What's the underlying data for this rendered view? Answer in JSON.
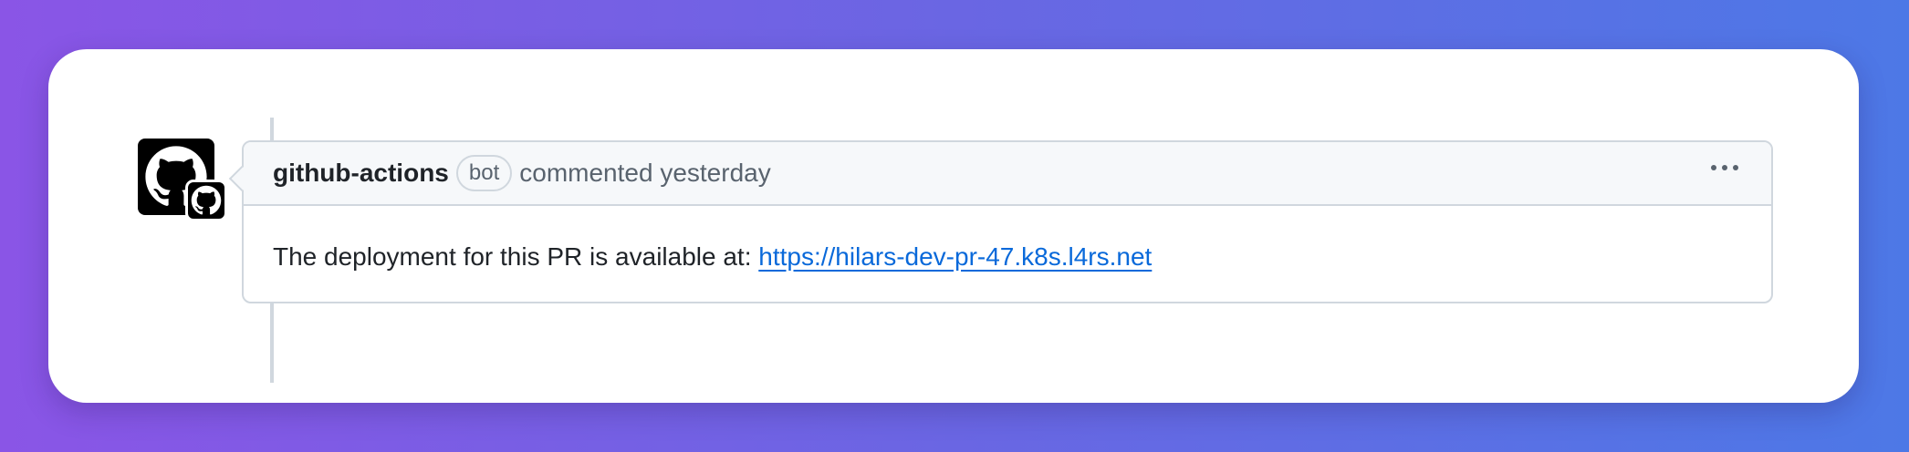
{
  "comment": {
    "author": "github-actions",
    "badge": "bot",
    "action": "commented yesterday",
    "body_text": "The deployment for this PR is available at:",
    "link_text": "https://hilars-dev-pr-47.k8s.l4rs.net"
  },
  "icons": {
    "avatar": "github-octocat-icon",
    "badge": "github-octocat-icon",
    "menu": "kebab-horizontal-icon"
  },
  "colors": {
    "link": "#0969da",
    "header_bg": "#f6f8fa",
    "border": "#d0d7de",
    "muted_text": "#59636e"
  }
}
